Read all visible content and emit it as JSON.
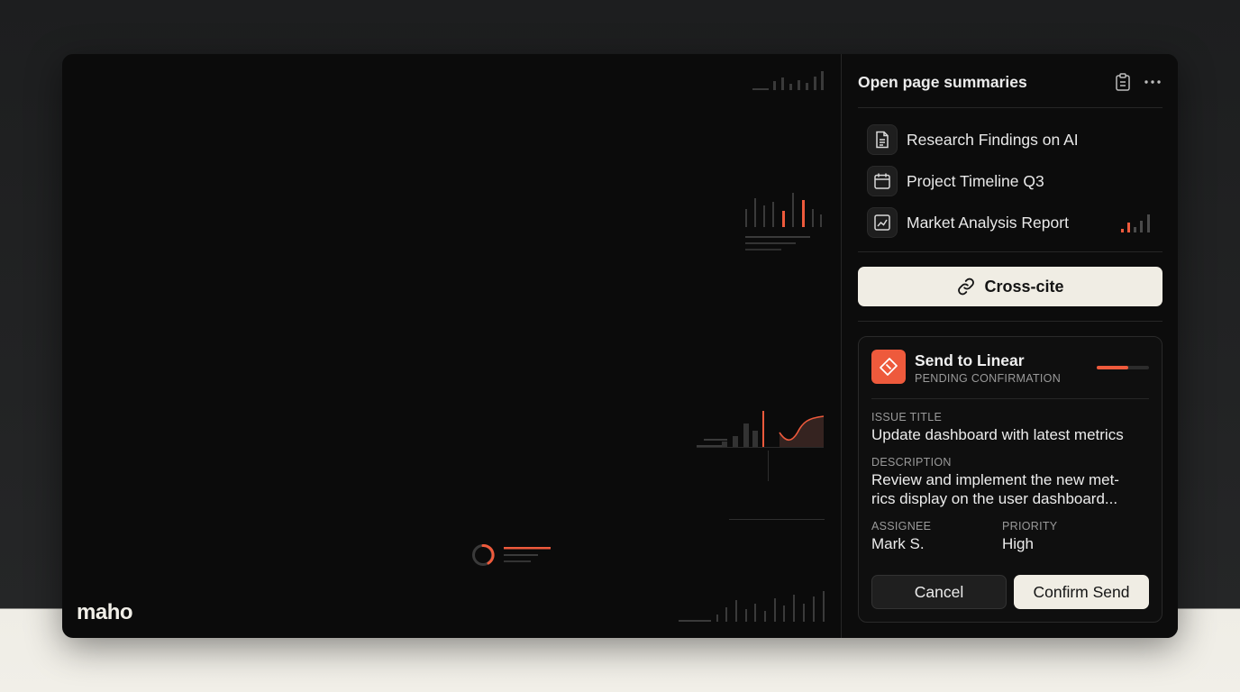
{
  "app": {
    "brand": "maho"
  },
  "panel": {
    "title": "Open page summaries",
    "header_icons": [
      "clipboard-icon",
      "more-icon"
    ],
    "items": [
      {
        "label": "Research Findings on AI",
        "icon": "document-icon"
      },
      {
        "label": "Project Timeline Q3",
        "icon": "calendar-icon"
      },
      {
        "label": "Market Analysis Report",
        "icon": "chart-icon"
      }
    ],
    "cross_cite_label": "Cross-cite"
  },
  "linear": {
    "title": "Send to Linear",
    "status": "PENDING CONFIRMATION",
    "progress": 0.6,
    "issue_title_label": "ISSUE TITLE",
    "issue_title": "Update dashboard with latest metrics",
    "description_label": "DESCRIPTION",
    "description_line1": "Review and implement the new met-",
    "description_line2": "rics display on the user dashboard...",
    "assignee_label": "ASSIGNEE",
    "assignee": "Mark S.",
    "priority_label": "PRIORITY",
    "priority": "High",
    "cancel_label": "Cancel",
    "confirm_label": "Confirm Send"
  },
  "colors": {
    "accent": "#ee5a3c",
    "cream": "#f0ede4",
    "window": "#0b0b0b"
  }
}
